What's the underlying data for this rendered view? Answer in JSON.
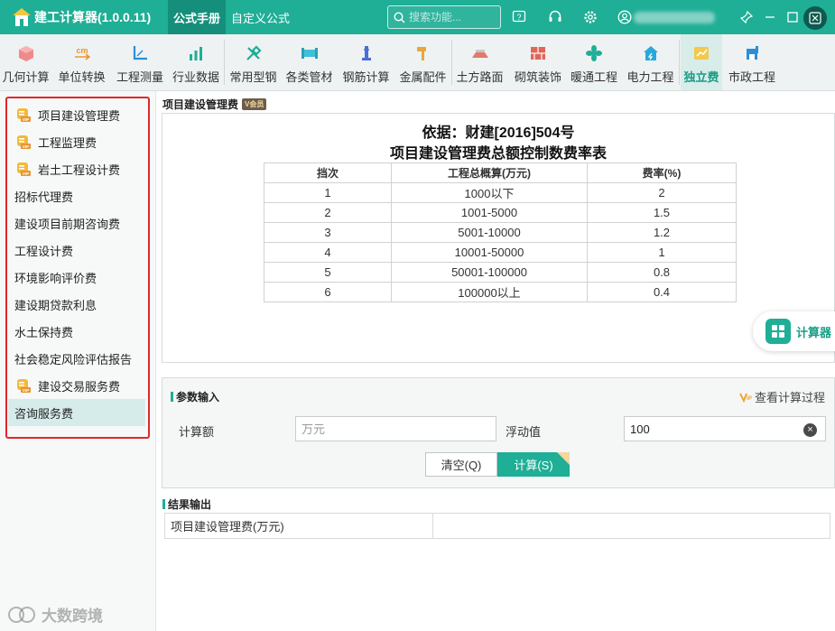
{
  "app": {
    "title": "建工计算器(1.0.0.11)"
  },
  "top_tabs": [
    "公式手册",
    "自定义公式"
  ],
  "search": {
    "placeholder": "搜索功能..."
  },
  "toolbar": {
    "items": [
      "几何计算",
      "单位转换",
      "工程测量",
      "行业数据",
      "常用型钢",
      "各类管材",
      "钢筋计算",
      "金属配件",
      "土方路面",
      "砌筑装饰",
      "暖通工程",
      "电力工程",
      "独立费",
      "市政工程"
    ],
    "active_index": 12
  },
  "sidebar": {
    "items": [
      {
        "label": "项目建设管理费",
        "vip": true
      },
      {
        "label": "工程监理费",
        "vip": true
      },
      {
        "label": "岩土工程设计费",
        "vip": true
      },
      {
        "label": "招标代理费",
        "vip": false
      },
      {
        "label": "建设项目前期咨询费",
        "vip": false
      },
      {
        "label": "工程设计费",
        "vip": false
      },
      {
        "label": "环境影响评价费",
        "vip": false
      },
      {
        "label": "建设期贷款利息",
        "vip": false
      },
      {
        "label": "水土保持费",
        "vip": false
      },
      {
        "label": "社会稳定风险评估报告",
        "vip": false
      },
      {
        "label": "建设交易服务费",
        "vip": true
      },
      {
        "label": "咨询服务费",
        "vip": false
      }
    ],
    "active_index": 11
  },
  "content": {
    "title": "项目建设管理费",
    "member_badge": "会员",
    "basis": "依据：财建[2016]504号",
    "table_title": "项目建设管理费总额控制数费率表",
    "table": {
      "headers": [
        "挡次",
        "工程总概算(万元)",
        "费率(%)"
      ],
      "rows": [
        [
          "1",
          "1000以下",
          "2"
        ],
        [
          "2",
          "1001-5000",
          "1.5"
        ],
        [
          "3",
          "5001-10000",
          "1.2"
        ],
        [
          "4",
          "10001-50000",
          "1"
        ],
        [
          "5",
          "50001-100000",
          "0.8"
        ],
        [
          "6",
          "100000以上",
          "0.4"
        ]
      ]
    },
    "calculator_label": "计算器"
  },
  "params": {
    "section_label": "参数输入",
    "view_process": "查看计算过程",
    "amount_label": "计算额",
    "amount_placeholder": "万元",
    "amount_value": "",
    "float_label": "浮动值",
    "float_value": "100",
    "clear_button": "清空(Q)",
    "calc_button": "计算(S)"
  },
  "result": {
    "section_label": "结果输出",
    "row_label": "项目建设管理费(万元)",
    "row_value": ""
  },
  "watermark": "大数跨境",
  "colors": {
    "accent": "#1fae96",
    "highlight_border": "#e0282c"
  }
}
